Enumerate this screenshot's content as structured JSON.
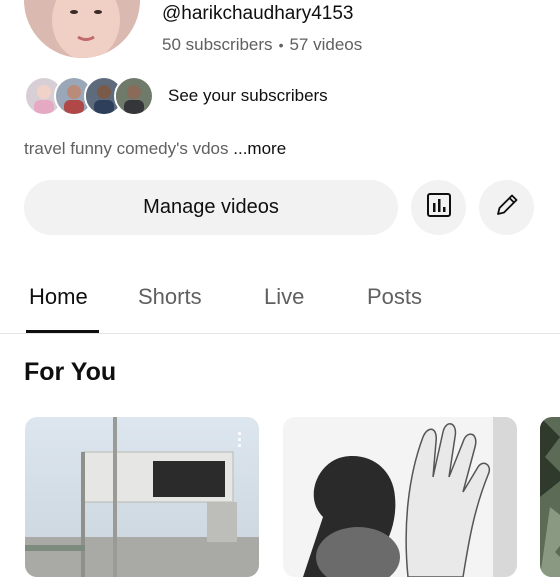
{
  "channel": {
    "handle": "@harikchaudhary4153",
    "subscribers": "50 subscribers",
    "videos": "57 videos",
    "separator": "•",
    "see_subscribers": "See your subscribers",
    "description": "travel funny comedy's vdos",
    "more_label": "...more"
  },
  "actions": {
    "manage_videos": "Manage videos",
    "analytics_icon": "analytics-icon",
    "edit_icon": "edit-pencil-icon"
  },
  "tabs": [
    {
      "label": "Home",
      "active": true
    },
    {
      "label": "Shorts",
      "active": false
    },
    {
      "label": "Live",
      "active": false
    },
    {
      "label": "Posts",
      "active": false
    }
  ],
  "section": {
    "title": "For You"
  },
  "colors": {
    "button_bg": "#f2f2f2",
    "secondary_text": "#606060",
    "primary_text": "#0f0f0f"
  }
}
